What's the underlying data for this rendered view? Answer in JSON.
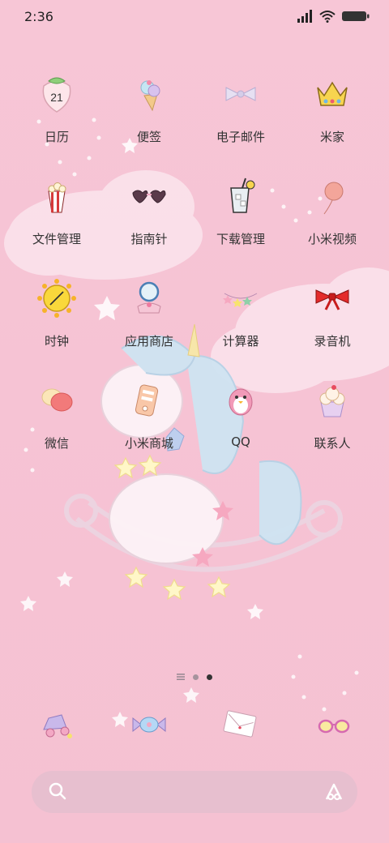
{
  "status": {
    "time": "2:36"
  },
  "apps": [
    {
      "label": "日历",
      "icon": "calendar-strawberry-icon",
      "badge": "21"
    },
    {
      "label": "便签",
      "icon": "ice-cream-notes-icon"
    },
    {
      "label": "电子邮件",
      "icon": "bow-mail-icon"
    },
    {
      "label": "米家",
      "icon": "crown-mijia-icon"
    },
    {
      "label": "文件管理",
      "icon": "popcorn-files-icon"
    },
    {
      "label": "指南针",
      "icon": "heart-glasses-compass-icon"
    },
    {
      "label": "下载管理",
      "icon": "drink-cup-downloads-icon"
    },
    {
      "label": "小米视频",
      "icon": "balloon-video-icon"
    },
    {
      "label": "时钟",
      "icon": "sun-clock-icon"
    },
    {
      "label": "应用商店",
      "icon": "ring-app-store-icon"
    },
    {
      "label": "计算器",
      "icon": "star-garland-calculator-icon"
    },
    {
      "label": "录音机",
      "icon": "red-bow-recorder-icon"
    },
    {
      "label": "微信",
      "icon": "bubbles-wechat-icon"
    },
    {
      "label": "小米商城",
      "icon": "phone-mi-store-icon"
    },
    {
      "label": "QQ",
      "icon": "penguin-qq-icon"
    },
    {
      "label": "联系人",
      "icon": "cupcake-contacts-icon"
    }
  ],
  "pager": {
    "count": 3,
    "active": 3
  },
  "dock": [
    {
      "icon": "toy-car-icon"
    },
    {
      "icon": "candy-icon"
    },
    {
      "icon": "envelope-icon"
    },
    {
      "icon": "sunglasses-icon"
    }
  ]
}
